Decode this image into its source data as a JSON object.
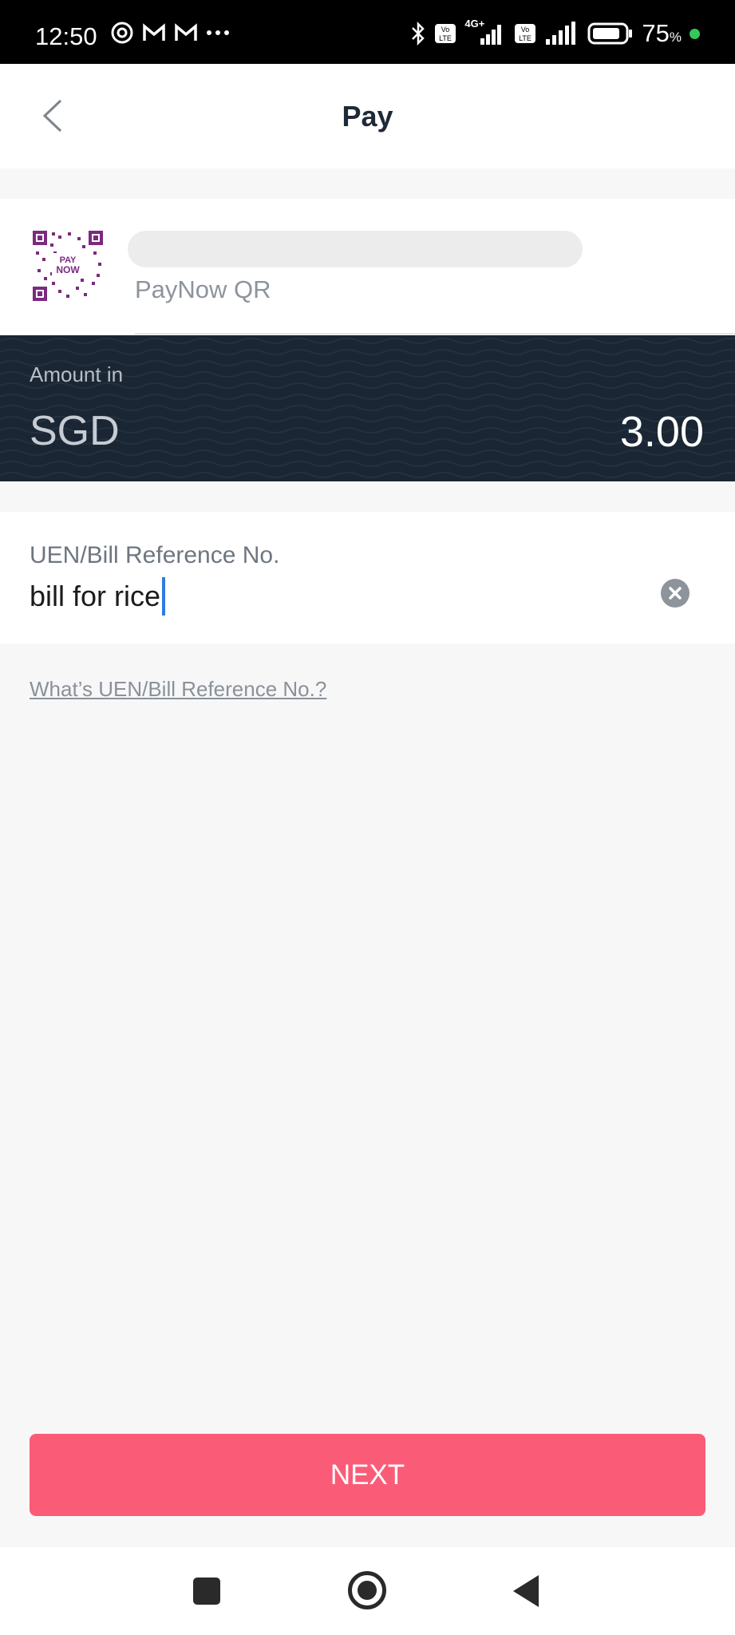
{
  "status_bar": {
    "time": "12:50",
    "battery_percent": "75",
    "battery_unit": "%",
    "network": "4G+"
  },
  "header": {
    "title": "Pay"
  },
  "merchant": {
    "type": "PayNow QR",
    "qr_badge_top": "PAY",
    "qr_badge_bottom": "NOW"
  },
  "amount": {
    "label": "Amount in",
    "currency": "SGD",
    "value": "3.00"
  },
  "reference": {
    "label": "UEN/Bill Reference No.",
    "value": "bill for rice",
    "help_link": "What’s UEN/Bill Reference No.?"
  },
  "actions": {
    "next_label": "NEXT"
  },
  "colors": {
    "accent": "#fa5c78",
    "amount_bg": "#1a2633",
    "caret": "#2f7be5",
    "paynow_purple": "#7b2a7f"
  }
}
